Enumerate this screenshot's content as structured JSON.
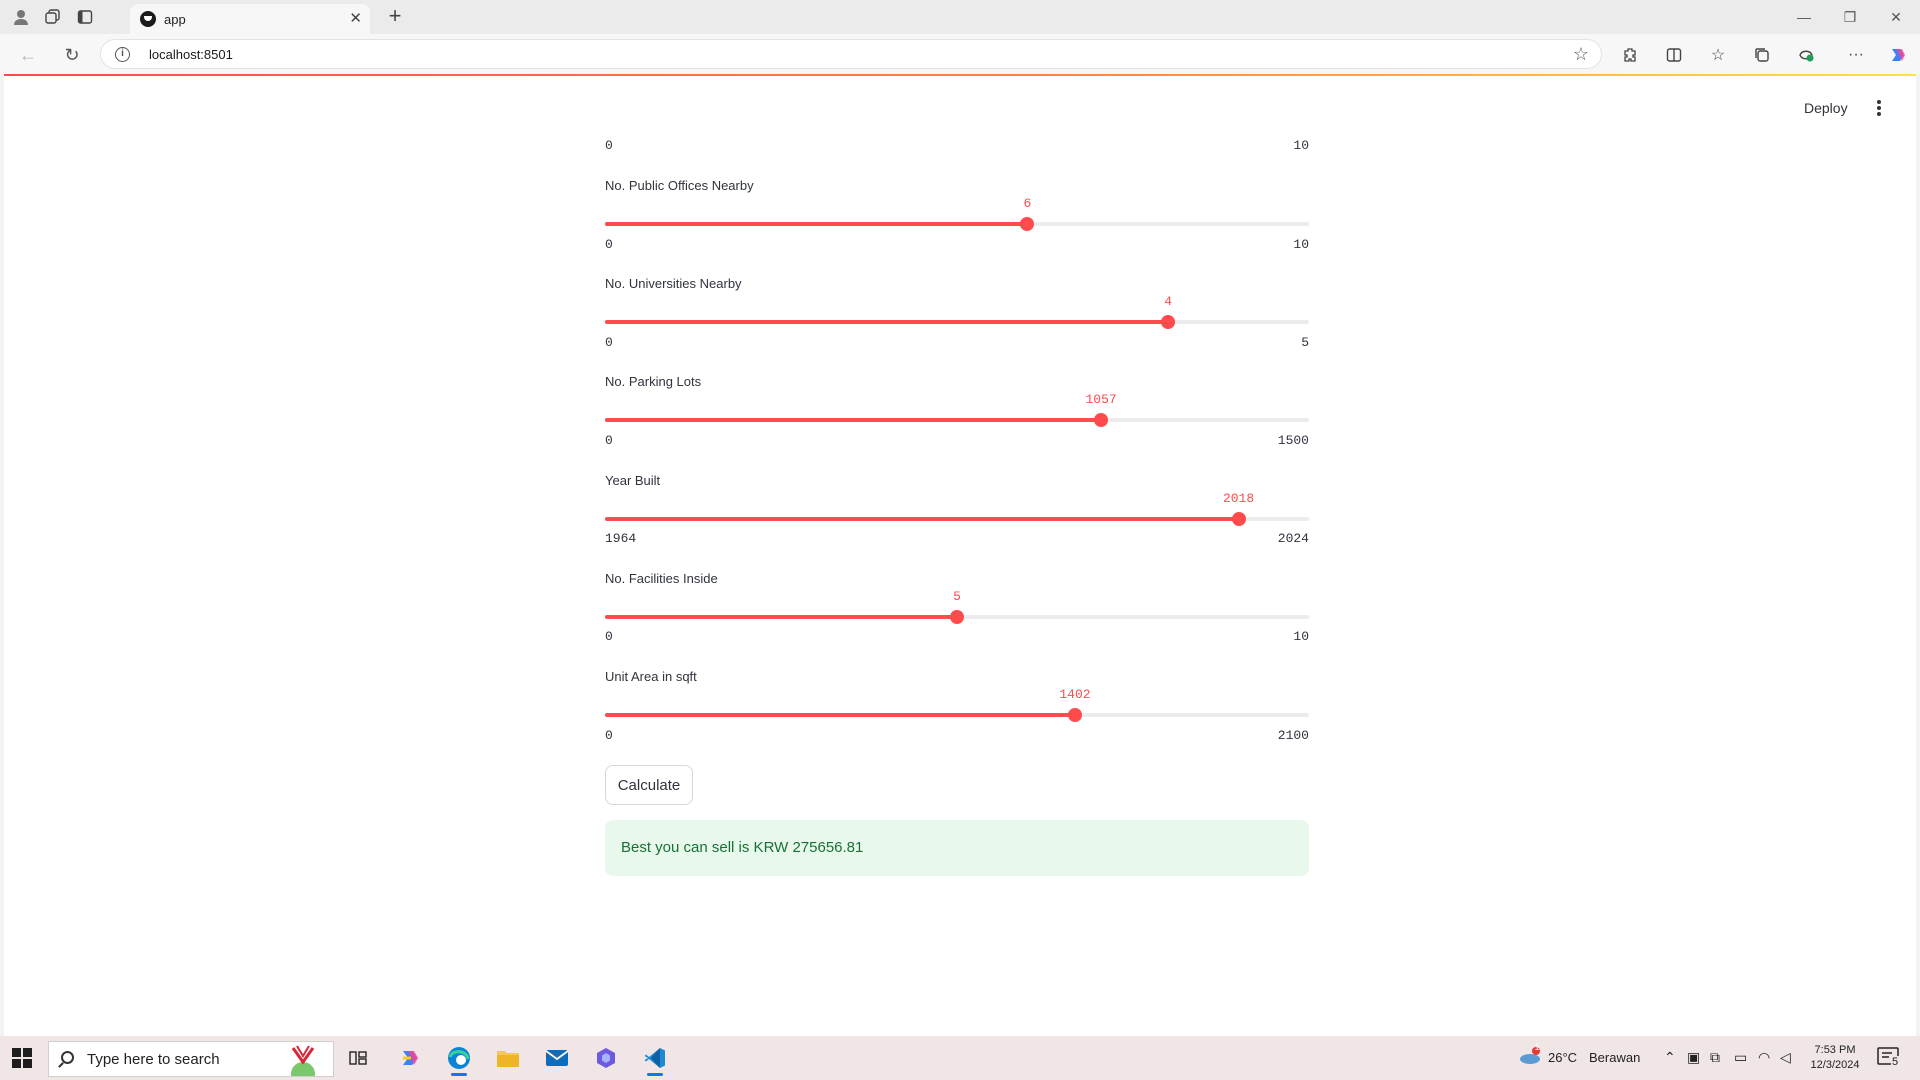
{
  "browser": {
    "tab_title": "app",
    "url": "localhost:8501"
  },
  "header": {
    "deploy_label": "Deploy"
  },
  "top_scale": {
    "min": "0",
    "max": "10"
  },
  "sliders": [
    {
      "label": "No. Public Offices Nearby",
      "value": "6",
      "min": "0",
      "max": "10",
      "fraction": 0.6
    },
    {
      "label": "No. Universities Nearby",
      "value": "4",
      "min": "0",
      "max": "5",
      "fraction": 0.8
    },
    {
      "label": "No. Parking Lots",
      "value": "1057",
      "min": "0",
      "max": "1500",
      "fraction": 0.7047
    },
    {
      "label": "Year Built",
      "value": "2018",
      "min": "1964",
      "max": "2024",
      "fraction": 0.9
    },
    {
      "label": "No. Facilities Inside",
      "value": "5",
      "min": "0",
      "max": "10",
      "fraction": 0.5
    },
    {
      "label": "Unit Area in sqft",
      "value": "1402",
      "min": "0",
      "max": "2100",
      "fraction": 0.6676
    }
  ],
  "calculate_label": "Calculate",
  "result_text": "Best you can sell is KRW 275656.81",
  "accent_color": "#ff4b4b",
  "success_bg": "#e8f8ed",
  "taskbar": {
    "search_placeholder": "Type here to search",
    "weather_badge": "1",
    "temperature": "26°C",
    "weather": "Berawan",
    "time": "7:53 PM",
    "date": "12/3/2024",
    "notification_count": "5"
  }
}
